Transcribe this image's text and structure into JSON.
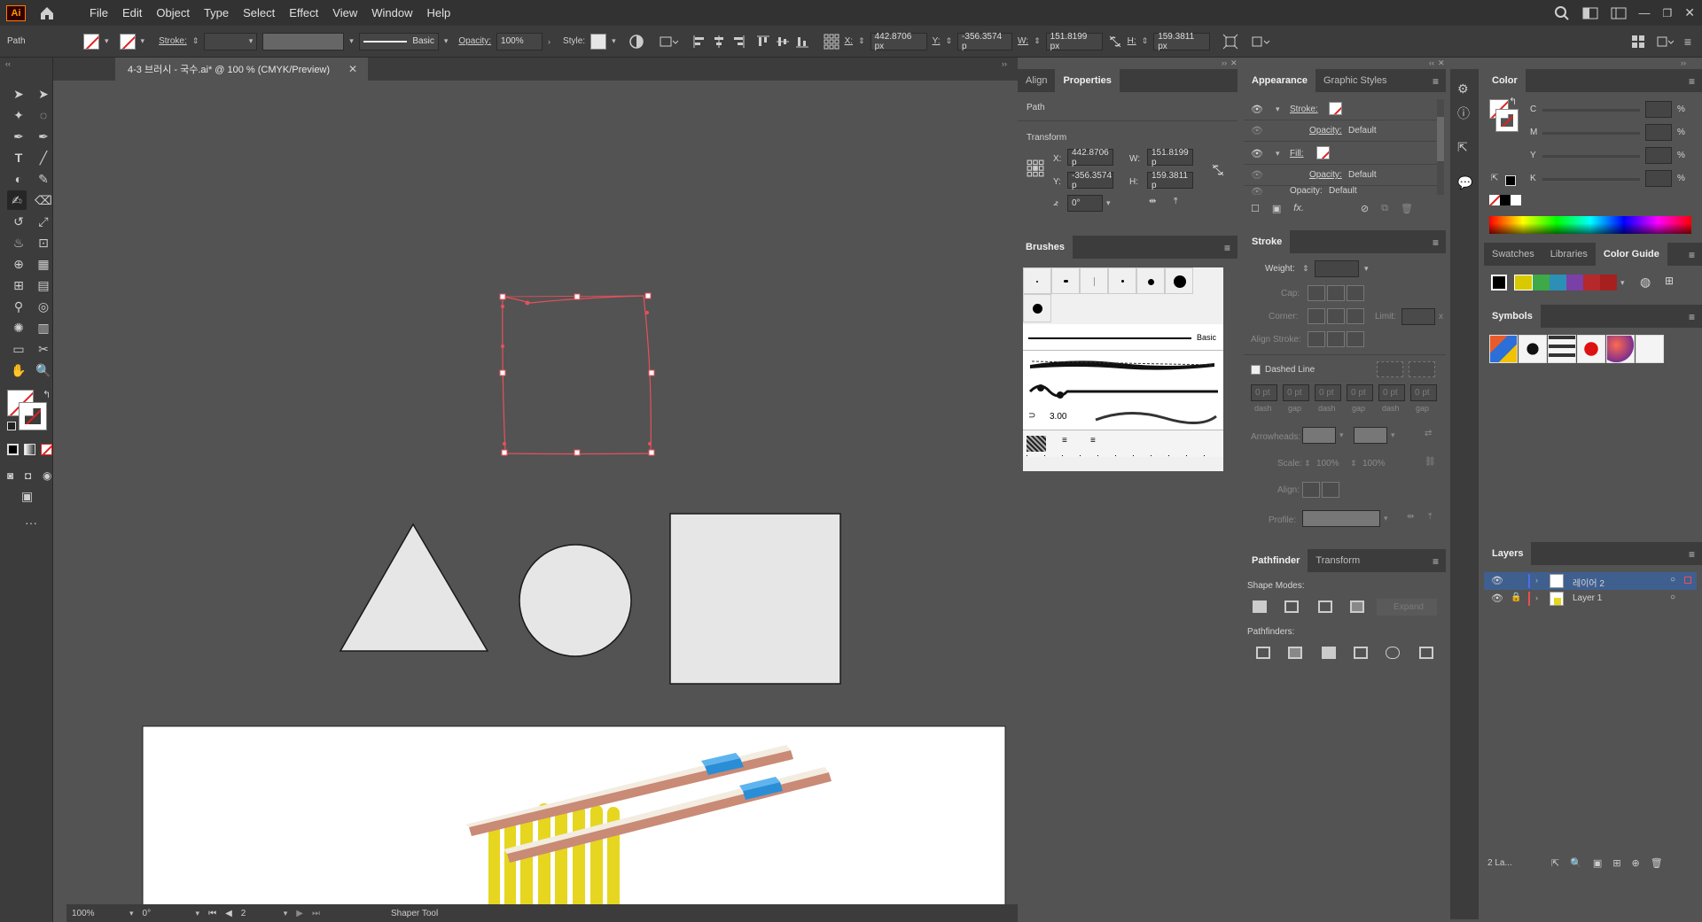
{
  "menubar": {
    "logo": "Ai",
    "items": [
      "File",
      "Edit",
      "Object",
      "Type",
      "Select",
      "Effect",
      "View",
      "Window",
      "Help"
    ]
  },
  "controlbar": {
    "selection_type": "Path",
    "stroke_label": "Stroke:",
    "brush_label": "Basic",
    "opacity_label": "Opacity:",
    "opacity_value": "100%",
    "style_label": "Style:",
    "x_label": "X:",
    "x_value": "442.8706 px",
    "y_label": "Y:",
    "y_value": "-356.3574 p",
    "w_label": "W:",
    "w_value": "151.8199 px",
    "h_label": "H:",
    "h_value": "159.3811 px"
  },
  "document": {
    "tab_title": "4-3 브러시 - 국수.ai* @ 100 % (CMYK/Preview)",
    "zoom": "100%",
    "rotation": "0°",
    "artboard": "2",
    "status_tool": "Shaper Tool"
  },
  "properties_panel": {
    "tabs": [
      "Align",
      "Properties"
    ],
    "section": "Path",
    "transform_label": "Transform",
    "x_label": "X:",
    "x_value": "442.8706 p",
    "y_label": "Y:",
    "y_value": "-356.3574 p",
    "w_label": "W:",
    "w_value": "151.8199 p",
    "h_label": "H:",
    "h_value": "159.3811 p",
    "angle_value": "0°"
  },
  "appearance_panel": {
    "tabs": [
      "Appearance",
      "Graphic Styles"
    ],
    "rows": [
      {
        "label": "Stroke:",
        "type": "swatch"
      },
      {
        "label": "Opacity:",
        "value": "Default"
      },
      {
        "label": "Fill:",
        "type": "swatch"
      },
      {
        "label": "Opacity:",
        "value": "Default"
      },
      {
        "label": "Opacity:",
        "value": "Default"
      }
    ]
  },
  "brushes_panel": {
    "tab": "Brushes",
    "basic_label": "Basic",
    "size_label": "3.00"
  },
  "stroke_panel": {
    "tab": "Stroke",
    "weight_label": "Weight:",
    "cap_label": "Cap:",
    "corner_label": "Corner:",
    "limit_label": "Limit:",
    "limit_unit": "x",
    "align_label": "Align Stroke:",
    "dashed_label": "Dashed Line",
    "dash_values": [
      "0 pt",
      "0 pt",
      "0 pt",
      "0 pt",
      "0 pt",
      "0 pt"
    ],
    "dash_labels": [
      "dash",
      "gap",
      "dash",
      "gap",
      "dash",
      "gap"
    ],
    "arrowheads_label": "Arrowheads:",
    "scale_label": "Scale:",
    "scale_values": [
      "100%",
      "100%"
    ],
    "align2_label": "Align:",
    "profile_label": "Profile:"
  },
  "pathfinder_panel": {
    "tabs": [
      "Pathfinder",
      "Transform"
    ],
    "shape_modes_label": "Shape Modes:",
    "expand_label": "Expand",
    "pathfinders_label": "Pathfinders:"
  },
  "color_panel": {
    "tab": "Color",
    "channels": [
      "C",
      "M",
      "Y",
      "K"
    ],
    "unit": "%"
  },
  "swatches_group": {
    "tabs": [
      "Swatches",
      "Libraries",
      "Color Guide"
    ]
  },
  "symbols_panel": {
    "tab": "Symbols"
  },
  "layers_panel": {
    "tab": "Layers",
    "layers": [
      {
        "name": "레이어 2",
        "color": "#4f6de8",
        "selected": true
      },
      {
        "name": "Layer 1",
        "color": "#e84f4f",
        "selected": false
      }
    ],
    "count_label": "2 La..."
  },
  "colors": {
    "selection": "#e8505b",
    "shape_fill": "#e6e6e6",
    "noodle": "#e6d61f",
    "chopstick_light": "#f3ece0",
    "chopstick_dark": "#c98a76",
    "chopstick_band": "#2a8ed6"
  }
}
